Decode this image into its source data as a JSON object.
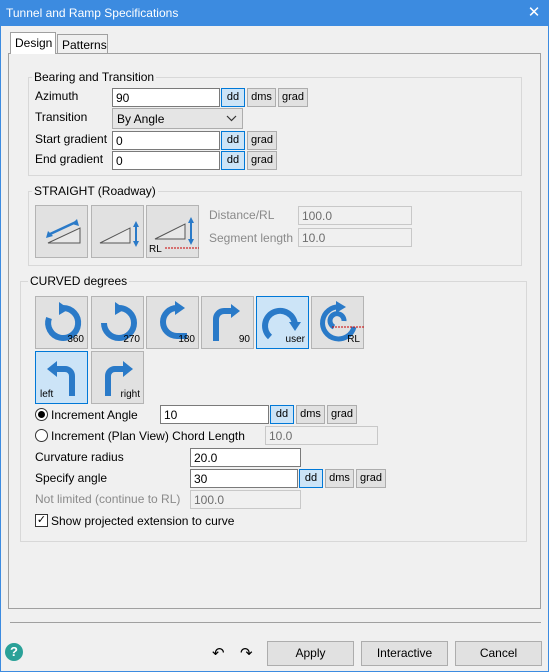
{
  "window": {
    "title": "Tunnel and Ramp Specifications",
    "close_glyph": "✕"
  },
  "tabs": [
    {
      "label": "Design",
      "active": true
    },
    {
      "label": "Patterns",
      "active": false
    }
  ],
  "bearing": {
    "title": "Bearing and Transition",
    "azimuth_label": "Azimuth",
    "azimuth_value": "90",
    "transition_label": "Transition",
    "transition_value": "By Angle",
    "start_gradient_label": "Start gradient",
    "start_gradient_value": "0",
    "end_gradient_label": "End gradient",
    "end_gradient_value": "0"
  },
  "units": {
    "dd": "dd",
    "dms": "dms",
    "grad": "grad"
  },
  "straight": {
    "title": "STRAIGHT (Roadway)",
    "rl_caption": "RL",
    "distance_label": "Distance/RL",
    "distance_value": "100.0",
    "segment_label": "Segment length",
    "segment_value": "10.0"
  },
  "curved": {
    "title": "CURVED degrees",
    "buttons": [
      "360",
      "270",
      "180",
      "90",
      "user",
      "RL"
    ],
    "direction_buttons": [
      "left",
      "right"
    ],
    "increment_angle_label": "Increment Angle",
    "increment_angle_value": "10",
    "chord_label": "Increment (Plan View) Chord Length",
    "chord_value": "10.0",
    "radius_label": "Curvature radius",
    "radius_value": "20.0",
    "specify_label": "Specify angle",
    "specify_value": "30",
    "not_limited_label": "Not limited (continue to RL)",
    "not_limited_value": "100.0",
    "show_extension_label": "Show projected extension to curve",
    "check_glyph": "✓"
  },
  "footer": {
    "help": "?",
    "undo": "↶",
    "redo": "↷",
    "apply": "Apply",
    "interactive": "Interactive",
    "cancel": "Cancel"
  },
  "colors": {
    "titlebar": "#3c8be0",
    "selected": "#cce4f7",
    "selected_border": "#0078d7",
    "icon_blue": "#2a7ac8"
  }
}
